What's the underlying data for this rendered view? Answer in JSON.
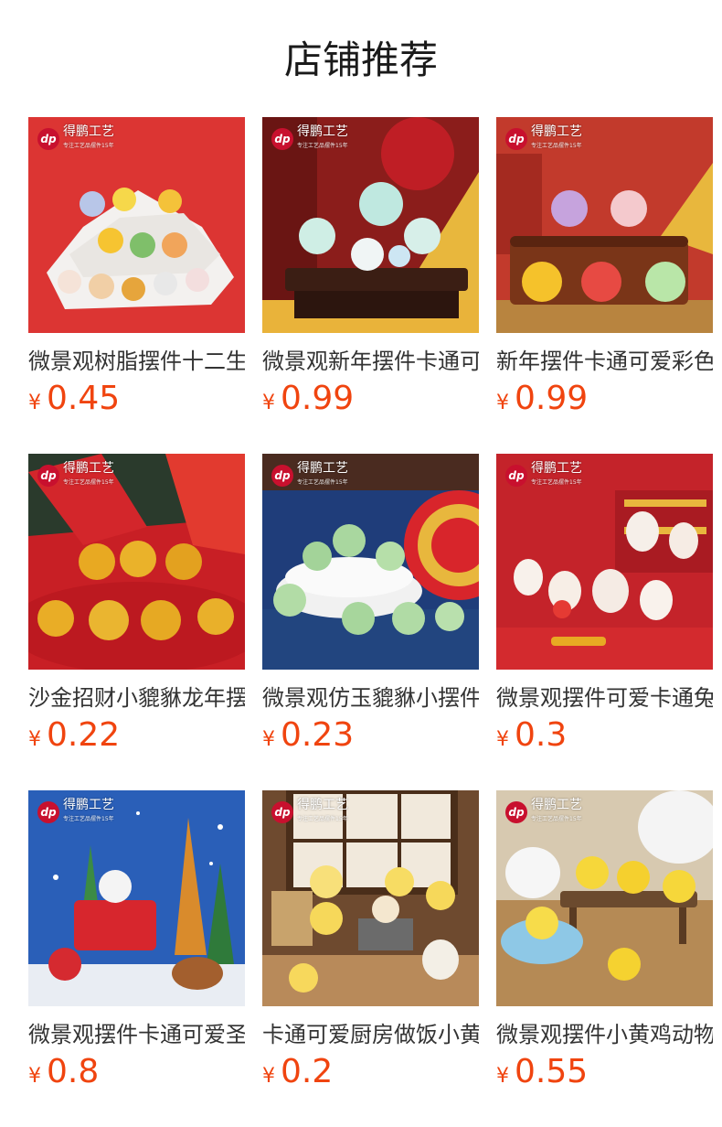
{
  "section_title": "店铺推荐",
  "colors": {
    "price": "#f0440f",
    "title": "#1a1a1a",
    "name": "#333333"
  },
  "brand": {
    "name": "得鹏工艺",
    "tagline": "专注工艺品摆件15年",
    "logo": "dp"
  },
  "products": [
    {
      "name": "微景观树脂摆件十二生肖",
      "currency": "¥",
      "price": "0.45",
      "image": "zodiac-animals-on-white-platform"
    },
    {
      "name": "微景观新年摆件卡通可爱",
      "currency": "¥",
      "price": "0.99",
      "image": "cartoon-dragons-on-wood-stand"
    },
    {
      "name": "新年摆件卡通可爱彩色龙",
      "currency": "¥",
      "price": "0.99",
      "image": "colorful-cartoon-dragons"
    },
    {
      "name": "沙金招财小貔貅龙年摆件",
      "currency": "¥",
      "price": "0.22",
      "image": "golden-pixiu-figures"
    },
    {
      "name": "微景观仿玉貔貅小摆件",
      "currency": "¥",
      "price": "0.23",
      "image": "jade-green-pixiu-figures"
    },
    {
      "name": "微景观摆件可爱卡通兔子",
      "currency": "¥",
      "price": "0.3",
      "image": "white-rabbit-figures"
    },
    {
      "name": "微景观摆件卡通可爱圣诞",
      "currency": "¥",
      "price": "0.8",
      "image": "christmas-santa-reindeer"
    },
    {
      "name": "卡通可爱厨房做饭小黄鸡",
      "currency": "¥",
      "price": "0.2",
      "image": "yellow-chicks-kitchen"
    },
    {
      "name": "微景观摆件小黄鸡动物",
      "currency": "¥",
      "price": "0.55",
      "image": "yellow-chicks-on-bench"
    }
  ]
}
